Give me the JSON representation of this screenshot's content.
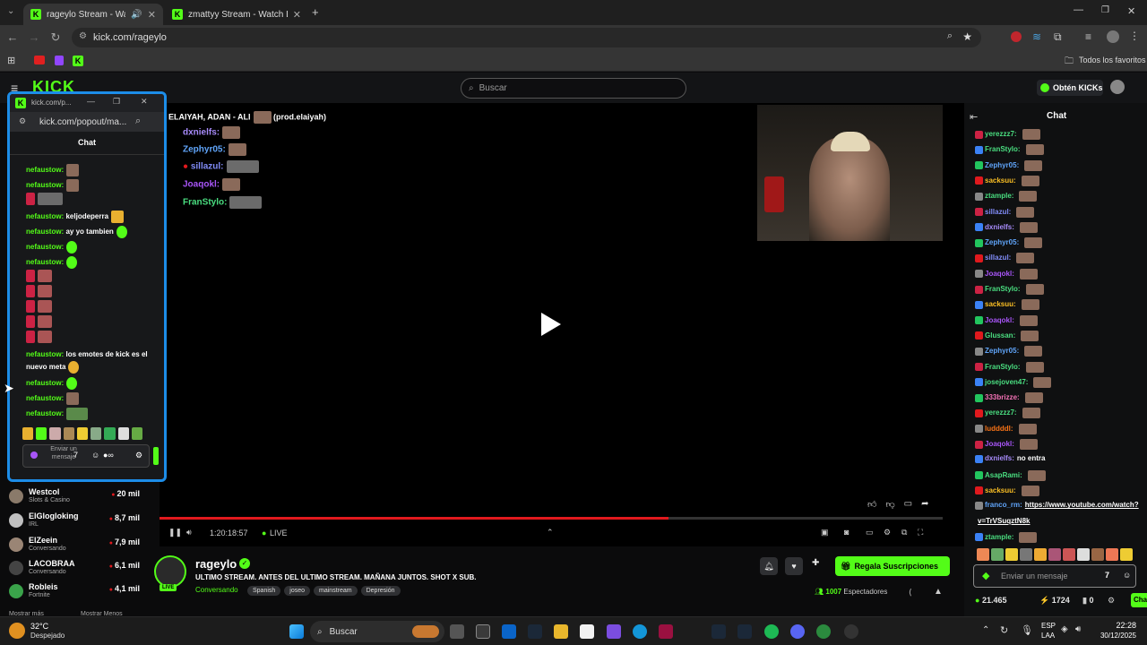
{
  "browser": {
    "tabs": [
      {
        "title": "rageylo Stream - Watch Live"
      },
      {
        "title": "zmattyy Stream - Watch Live or"
      }
    ],
    "url": "kick.com/rageylo",
    "bookmarks_label": "Todos los favoritos"
  },
  "site": {
    "search_placeholder": "Buscar",
    "get_kicks_label": "Obtén KICKs"
  },
  "popup": {
    "title": "kick.com/p...",
    "url": "kick.com/popout/ma...",
    "chat_title": "Chat",
    "input_placeholder": "Enviar un mensaje",
    "messages": [
      {
        "user": "nefaustow:",
        "text": ""
      },
      {
        "user": "nefaustow:",
        "text": ""
      },
      {
        "user": "nefaustow:",
        "text": "keljodeperra"
      },
      {
        "user": "nefaustow:",
        "text": "ay yo tambien"
      },
      {
        "user": "nefaustow:",
        "text": ""
      },
      {
        "user": "nefaustow:",
        "text": ""
      },
      {
        "user": "nefaustow:",
        "text": "los emotes de kick es el"
      },
      {
        "user": "",
        "text": "nuevo meta"
      },
      {
        "user": "nefaustow:",
        "text": ""
      },
      {
        "user": "nefaustow:",
        "text": ""
      },
      {
        "user": "nefaustow:",
        "text": ""
      }
    ]
  },
  "video": {
    "overlay_title": "ELAIYAH, ADAN - ALI",
    "overlay_credit": "(prod.elaiyah)",
    "chat": [
      {
        "user": "dxnielfs:",
        "color": "#a78bfa"
      },
      {
        "user": "Zephyr05:",
        "color": "#60a5fa"
      },
      {
        "user": "sillazul:",
        "color": "#818cf8"
      },
      {
        "user": "Joaqokl:",
        "color": "#a855f7"
      },
      {
        "user": "FranStylo:",
        "color": "#4ade80"
      }
    ],
    "time": "1:20:18:57",
    "live_label": "LIVE",
    "progress": 0.65
  },
  "following": {
    "items": [
      {
        "name": "Westcol",
        "category": "Slots & Casino",
        "viewers": "20 mil"
      },
      {
        "name": "ElGlogloking",
        "category": "IRL",
        "viewers": "8,7 mil"
      },
      {
        "name": "ElZeein",
        "category": "Conversando",
        "viewers": "7,9 mil"
      },
      {
        "name": "LACOBRAA",
        "category": "Conversando",
        "viewers": "6,1 mil"
      },
      {
        "name": "Robleis",
        "category": "Fortnite",
        "viewers": "4,1 mil"
      }
    ],
    "show_more": "Mostrar más",
    "show_less": "Mostrar Menos"
  },
  "stream": {
    "channel": "rageylo",
    "title": "ULTIMO STREAM. ANTES DEL ULTIMO STREAM. MAÑANA JUNTOS. SHOT X SUB.",
    "category": "Conversando",
    "tags": [
      "Spanish",
      "joseo",
      "mainstream",
      "Depresión"
    ],
    "subscribe_label": "Regala Suscripciones",
    "viewers": "1007",
    "viewers_label": "Espectadores",
    "live_badge": "LIVE"
  },
  "chat": {
    "title": "Chat",
    "input_placeholder": "Enviar un mensaje",
    "kicks": "21.465",
    "points": "1724",
    "count": "0",
    "chat_button": "Chat",
    "messages": [
      {
        "user": "yerezzz7:",
        "color": "#4ade80",
        "text": ""
      },
      {
        "user": "FranStylo:",
        "color": "#4ade80",
        "text": ""
      },
      {
        "user": "Zephyr05:",
        "color": "#60a5fa",
        "text": ""
      },
      {
        "user": "sacksuu:",
        "color": "#fbbf24",
        "text": ""
      },
      {
        "user": "ztample:",
        "color": "#4ade80",
        "text": ""
      },
      {
        "user": "sillazul:",
        "color": "#818cf8",
        "text": ""
      },
      {
        "user": "dxnielfs:",
        "color": "#a78bfa",
        "text": ""
      },
      {
        "user": "Zephyr05:",
        "color": "#60a5fa",
        "text": ""
      },
      {
        "user": "sillazul:",
        "color": "#818cf8",
        "text": ""
      },
      {
        "user": "Joaqokl:",
        "color": "#a855f7",
        "text": ""
      },
      {
        "user": "FranStylo:",
        "color": "#4ade80",
        "text": ""
      },
      {
        "user": "sacksuu:",
        "color": "#fbbf24",
        "text": ""
      },
      {
        "user": "Joaqokl:",
        "color": "#a855f7",
        "text": ""
      },
      {
        "user": "Glussan:",
        "color": "#4ade80",
        "text": ""
      },
      {
        "user": "Zephyr05:",
        "color": "#60a5fa",
        "text": ""
      },
      {
        "user": "FranStylo:",
        "color": "#4ade80",
        "text": ""
      },
      {
        "user": "josejoven47:",
        "color": "#4ade80",
        "text": ""
      },
      {
        "user": "333brizze:",
        "color": "#f472b6",
        "text": ""
      },
      {
        "user": "yerezzz7:",
        "color": "#4ade80",
        "text": ""
      },
      {
        "user": "luddddl:",
        "color": "#f97316",
        "text": ""
      },
      {
        "user": "Joaqokl:",
        "color": "#a855f7",
        "text": ""
      },
      {
        "user": "dxnielfs:",
        "color": "#a78bfa",
        "text": "no entra"
      },
      {
        "user": "AsapRami:",
        "color": "#4ade80",
        "text": ""
      },
      {
        "user": "sacksuu:",
        "color": "#fbbf24",
        "text": ""
      },
      {
        "user": "franco_rm:",
        "color": "#60a5fa",
        "text": "https://www.youtube.com/watch?"
      },
      {
        "user": "",
        "color": "#60a5fa",
        "text": "v=TrVSuqztN8k"
      },
      {
        "user": "ztample:",
        "color": "#4ade80",
        "text": ""
      }
    ]
  },
  "taskbar": {
    "temp": "32°C",
    "weather": "Despejado",
    "search": "Buscar",
    "lang": "ESP",
    "lang2": "LAA",
    "time": "22:28",
    "date": "30/12/2025"
  }
}
